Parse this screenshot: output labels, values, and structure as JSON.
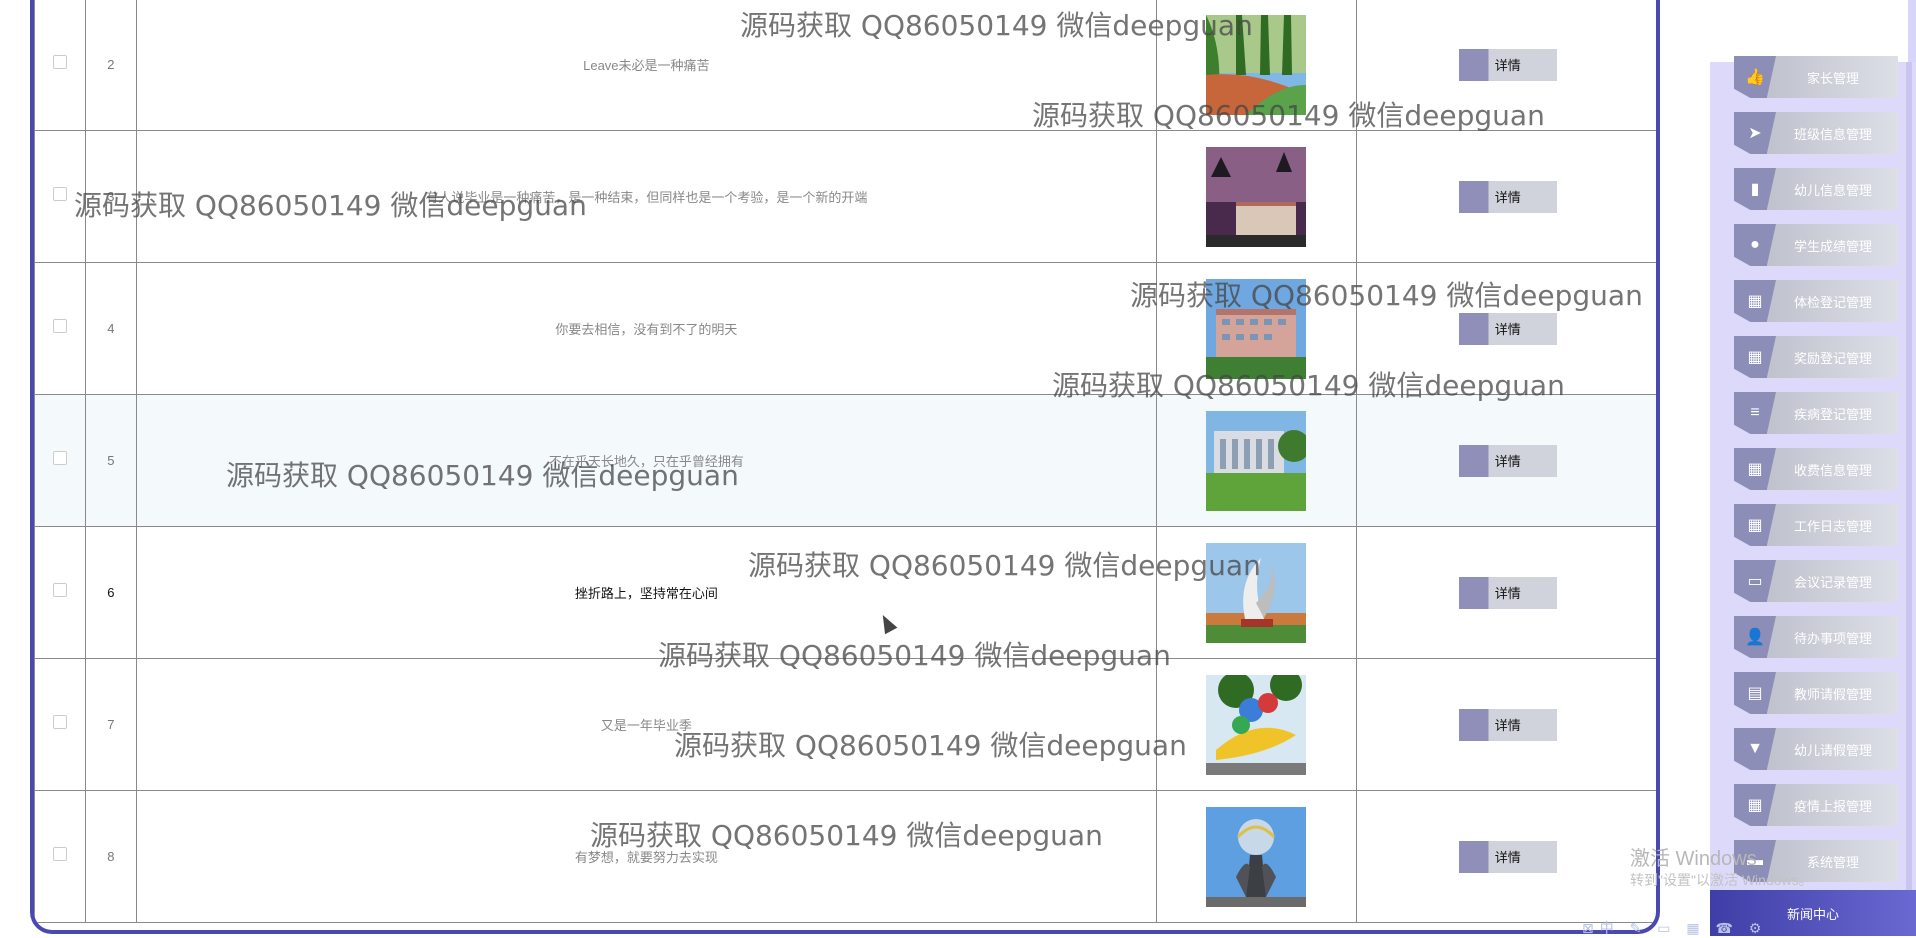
{
  "table": {
    "action_label": "详情",
    "rows": [
      {
        "index": "2",
        "title": "Leave未必是一种痛苦",
        "image": "tree-lined-track"
      },
      {
        "index": "3",
        "title": "有人说毕业是一种痛苦，是一种结束，但同样也是一个考验，是一个新的开端",
        "image": "campus-night"
      },
      {
        "index": "4",
        "title": "你要去相信，没有到不了的明天",
        "image": "campus-building"
      },
      {
        "index": "5",
        "title": "不在乎天长地久，只在乎曾经拥有",
        "image": "campus-lawn"
      },
      {
        "index": "6",
        "title": "挫折路上，坚持常在心间",
        "image": "sculpture"
      },
      {
        "index": "7",
        "title": "又是一年毕业季",
        "image": "colorful-sculpture"
      },
      {
        "index": "8",
        "title": "有梦想，就要努力去实现",
        "image": "globe-monument"
      }
    ]
  },
  "sidebar": {
    "items": [
      {
        "label": "家长管理",
        "icon": "thumb-icon"
      },
      {
        "label": "班级信息管理",
        "icon": "send-icon"
      },
      {
        "label": "幼儿信息管理",
        "icon": "chart-icon"
      },
      {
        "label": "学生成绩管理",
        "icon": "bulb-icon"
      },
      {
        "label": "体检登记管理",
        "icon": "grid-icon"
      },
      {
        "label": "奖励登记管理",
        "icon": "grid-icon"
      },
      {
        "label": "疾病登记管理",
        "icon": "list-icon"
      },
      {
        "label": "收费信息管理",
        "icon": "grid-icon"
      },
      {
        "label": "工作日志管理",
        "icon": "table-icon"
      },
      {
        "label": "会议记录管理",
        "icon": "monitor-icon"
      },
      {
        "label": "待办事项管理",
        "icon": "user-icon"
      },
      {
        "label": "教师请假管理",
        "icon": "clipboard-icon"
      },
      {
        "label": "幼儿请假管理",
        "icon": "pin-icon"
      },
      {
        "label": "疫情上报管理",
        "icon": "grid-icon"
      },
      {
        "label": "系统管理",
        "icon": "briefcase-icon"
      }
    ],
    "bottom_label": "新闻中心"
  },
  "watermark": "源码获取 QQ86050149 微信deepguan",
  "os_overlay": {
    "line1": "激活 Windows",
    "line2": "转到\"设置\"以激活 Windows。"
  },
  "colors": {
    "accent": "#4a49b0",
    "sidebar_bg": "#ddd9fb",
    "button_icon": "#8f8fba"
  }
}
